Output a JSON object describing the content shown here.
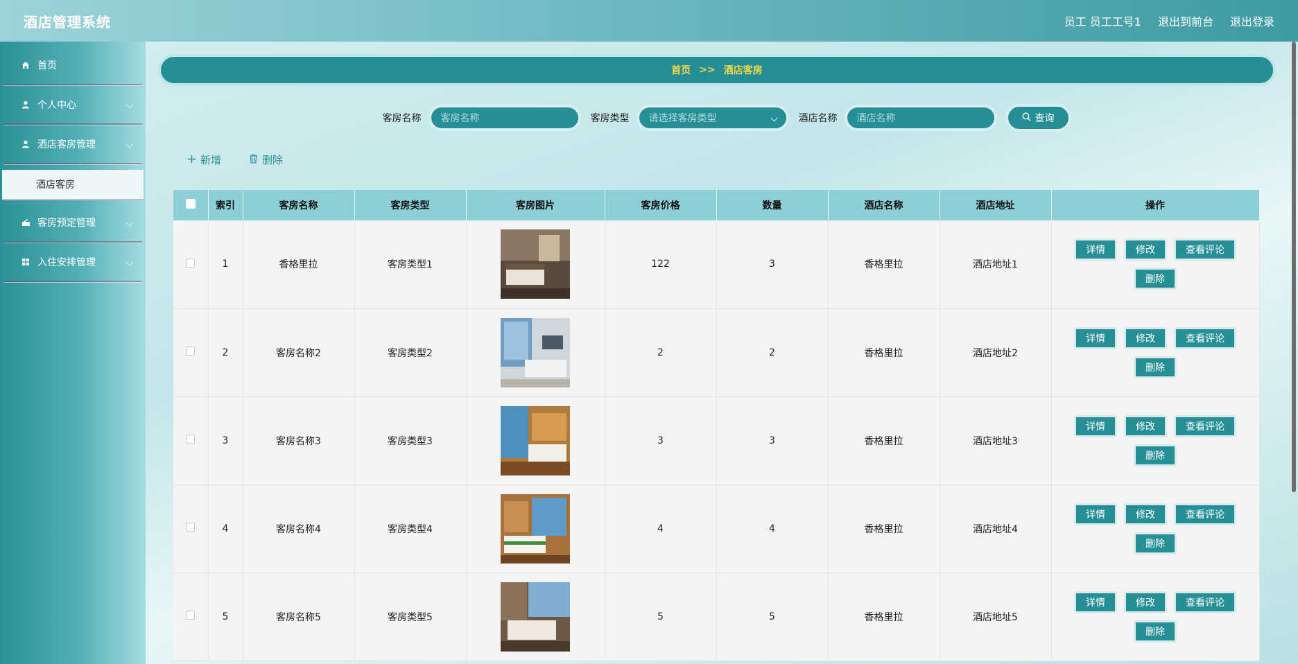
{
  "header": {
    "app_title": "酒店管理系统",
    "user_label": "员工 员工工号1",
    "back_to_front": "退出到前台",
    "logout": "退出登录"
  },
  "sidebar": {
    "items": [
      {
        "label": "首页",
        "icon": "home-icon"
      },
      {
        "label": "个人中心",
        "icon": "user-icon"
      },
      {
        "label": "酒店客房管理",
        "icon": "user-icon"
      },
      {
        "label": "客房预定管理",
        "icon": "booking-icon"
      },
      {
        "label": "入住安排管理",
        "icon": "grid-icon"
      }
    ],
    "active_sub": "酒店客房"
  },
  "breadcrumb": {
    "home": "首页",
    "sep": ">>",
    "current": "酒店客房"
  },
  "search": {
    "room_name_label": "客房名称",
    "room_name_placeholder": "客房名称",
    "room_type_label": "客房类型",
    "room_type_placeholder": "请选择客房类型",
    "hotel_name_label": "酒店名称",
    "hotel_name_placeholder": "酒店名称",
    "query_label": "查询"
  },
  "actions": {
    "add": "新增",
    "delete": "删除"
  },
  "table": {
    "headers": [
      "索引",
      "客房名称",
      "客房类型",
      "客房图片",
      "客房价格",
      "数量",
      "酒店名称",
      "酒店地址",
      "操作"
    ],
    "op_labels": {
      "detail": "详情",
      "edit": "修改",
      "comments": "查看评论",
      "delete": "删除"
    },
    "rows": [
      {
        "index": "1",
        "name": "香格里拉",
        "type": "客房类型1",
        "price": "122",
        "qty": "3",
        "hotel": "香格里拉",
        "address": "酒店地址1"
      },
      {
        "index": "2",
        "name": "客房名称2",
        "type": "客房类型2",
        "price": "2",
        "qty": "2",
        "hotel": "香格里拉",
        "address": "酒店地址2"
      },
      {
        "index": "3",
        "name": "客房名称3",
        "type": "客房类型3",
        "price": "3",
        "qty": "3",
        "hotel": "香格里拉",
        "address": "酒店地址3"
      },
      {
        "index": "4",
        "name": "客房名称4",
        "type": "客房类型4",
        "price": "4",
        "qty": "4",
        "hotel": "香格里拉",
        "address": "酒店地址4"
      },
      {
        "index": "5",
        "name": "客房名称5",
        "type": "客房类型5",
        "price": "5",
        "qty": "5",
        "hotel": "香格里拉",
        "address": "酒店地址5"
      }
    ]
  },
  "colors": {
    "primary": "#268f96",
    "breadcrumb_text": "#f5d84a",
    "table_header": "#8ccfd6"
  }
}
